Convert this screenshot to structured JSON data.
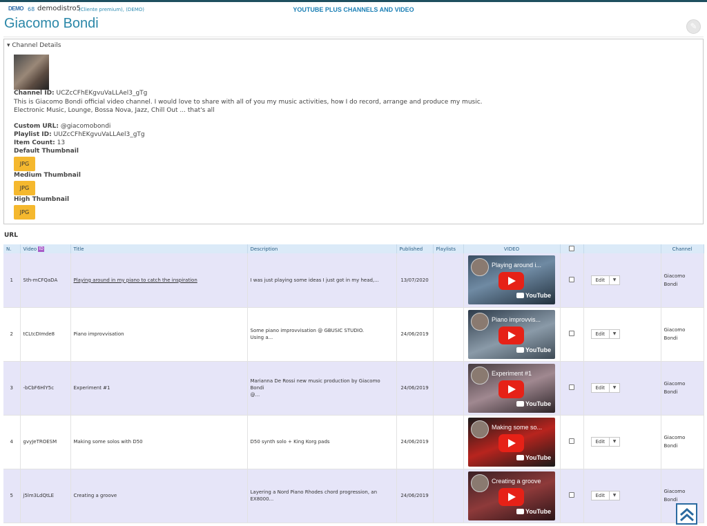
{
  "header": {
    "demo_logo": "DEMO",
    "user_number": "68",
    "username": "demodistro5",
    "user_tag": "(Cliente premium), (DEMO)",
    "app_title": "YOUTUBE PLUS CHANNELS AND VIDEO"
  },
  "page": {
    "title": "Giacomo Bondi",
    "edit_icon": "pencil-icon"
  },
  "channel_details": {
    "legend": "▾ Channel Details",
    "channel_id_label": "Channel ID:",
    "channel_id": "UCZcCFhEKgvuVaLLAel3_gTg",
    "description_line1": "This is Giacomo Bondi official video channel. I would love to share with all of you my music activities, how I do record, arrange and produce my music.",
    "description_line2": "Electronic Music, Lounge, Bossa Nova, Jazz, Chill Out ... that's all",
    "custom_url_label": "Custom URL:",
    "custom_url": "@giacomobondi",
    "playlist_id_label": "Playlist ID:",
    "playlist_id": "UUZcCFhEKgvuVaLLAel3_gTg",
    "item_count_label": "Item Count:",
    "item_count": "13",
    "default_thumb_label": "Default Thumbnail",
    "medium_thumb_label": "Medium Thumbnail",
    "high_thumb_label": "High Thumbnail",
    "jpg_label": "JPG"
  },
  "url_label": "URL",
  "table": {
    "columns": {
      "n": "N.",
      "video": "Video",
      "video_icon": "ID",
      "title": "Title",
      "description": "Description",
      "published": "Published",
      "playlists": "Playlists",
      "video_col": "VIDEO",
      "channel": "Channel"
    },
    "edit_label": "Edit",
    "youtube_label": "YouTube",
    "rows": [
      {
        "n": "1",
        "video_id": "Sth-mCFQaDA",
        "title": "Playing around in my piano to catch the inspiration",
        "description": "I was just playing some ideas I just got in my head,...",
        "published": "13/07/2020",
        "playlists": "",
        "thumb_title": "Playing around i...",
        "channel_line1": "Giacomo",
        "channel_line2": "Bondi"
      },
      {
        "n": "2",
        "video_id": "tCLtcDImde8",
        "title": "Piano improvvisation",
        "description": "Some piano improvvisation @ GBUSIC STUDIO.\nUsing a...",
        "published": "24/06/2019",
        "playlists": "",
        "thumb_title": "Piano improvvis...",
        "channel_line1": "Giacomo",
        "channel_line2": "Bondi"
      },
      {
        "n": "3",
        "video_id": "-bCbF6HlY5c",
        "title": "Experiment #1",
        "description": "Marianna De Rossi new music production by Giacomo Bondi\n@...",
        "published": "24/06/2019",
        "playlists": "",
        "thumb_title": "Experiment #1",
        "channel_line1": "Giacomo",
        "channel_line2": "Bondi"
      },
      {
        "n": "4",
        "video_id": "gvyJeTROESM",
        "title": "Making some solos with D50",
        "description": "D50 synth solo + King Korg pads",
        "published": "24/06/2019",
        "playlists": "",
        "thumb_title": "Making some so...",
        "channel_line1": "Giacomo",
        "channel_line2": "Bondi"
      },
      {
        "n": "5",
        "video_id": "j5lm3LdQtLE",
        "title": "Creating a groove",
        "description": "Layering a Nord Piano Rhodes chord progression, an\nEX8000...",
        "published": "24/06/2019",
        "playlists": "",
        "thumb_title": "Creating a groove",
        "channel_line1": "Giacomo",
        "channel_line2": "Bondi"
      }
    ]
  },
  "colors": {
    "accent": "#2a87a8",
    "header_row": "#dbeaf8",
    "odd_row": "#e6e5f8",
    "jpg_button": "#f5b82e",
    "youtube_red": "#e62117"
  },
  "scroll_top_icon": "double-chevron-up-icon"
}
